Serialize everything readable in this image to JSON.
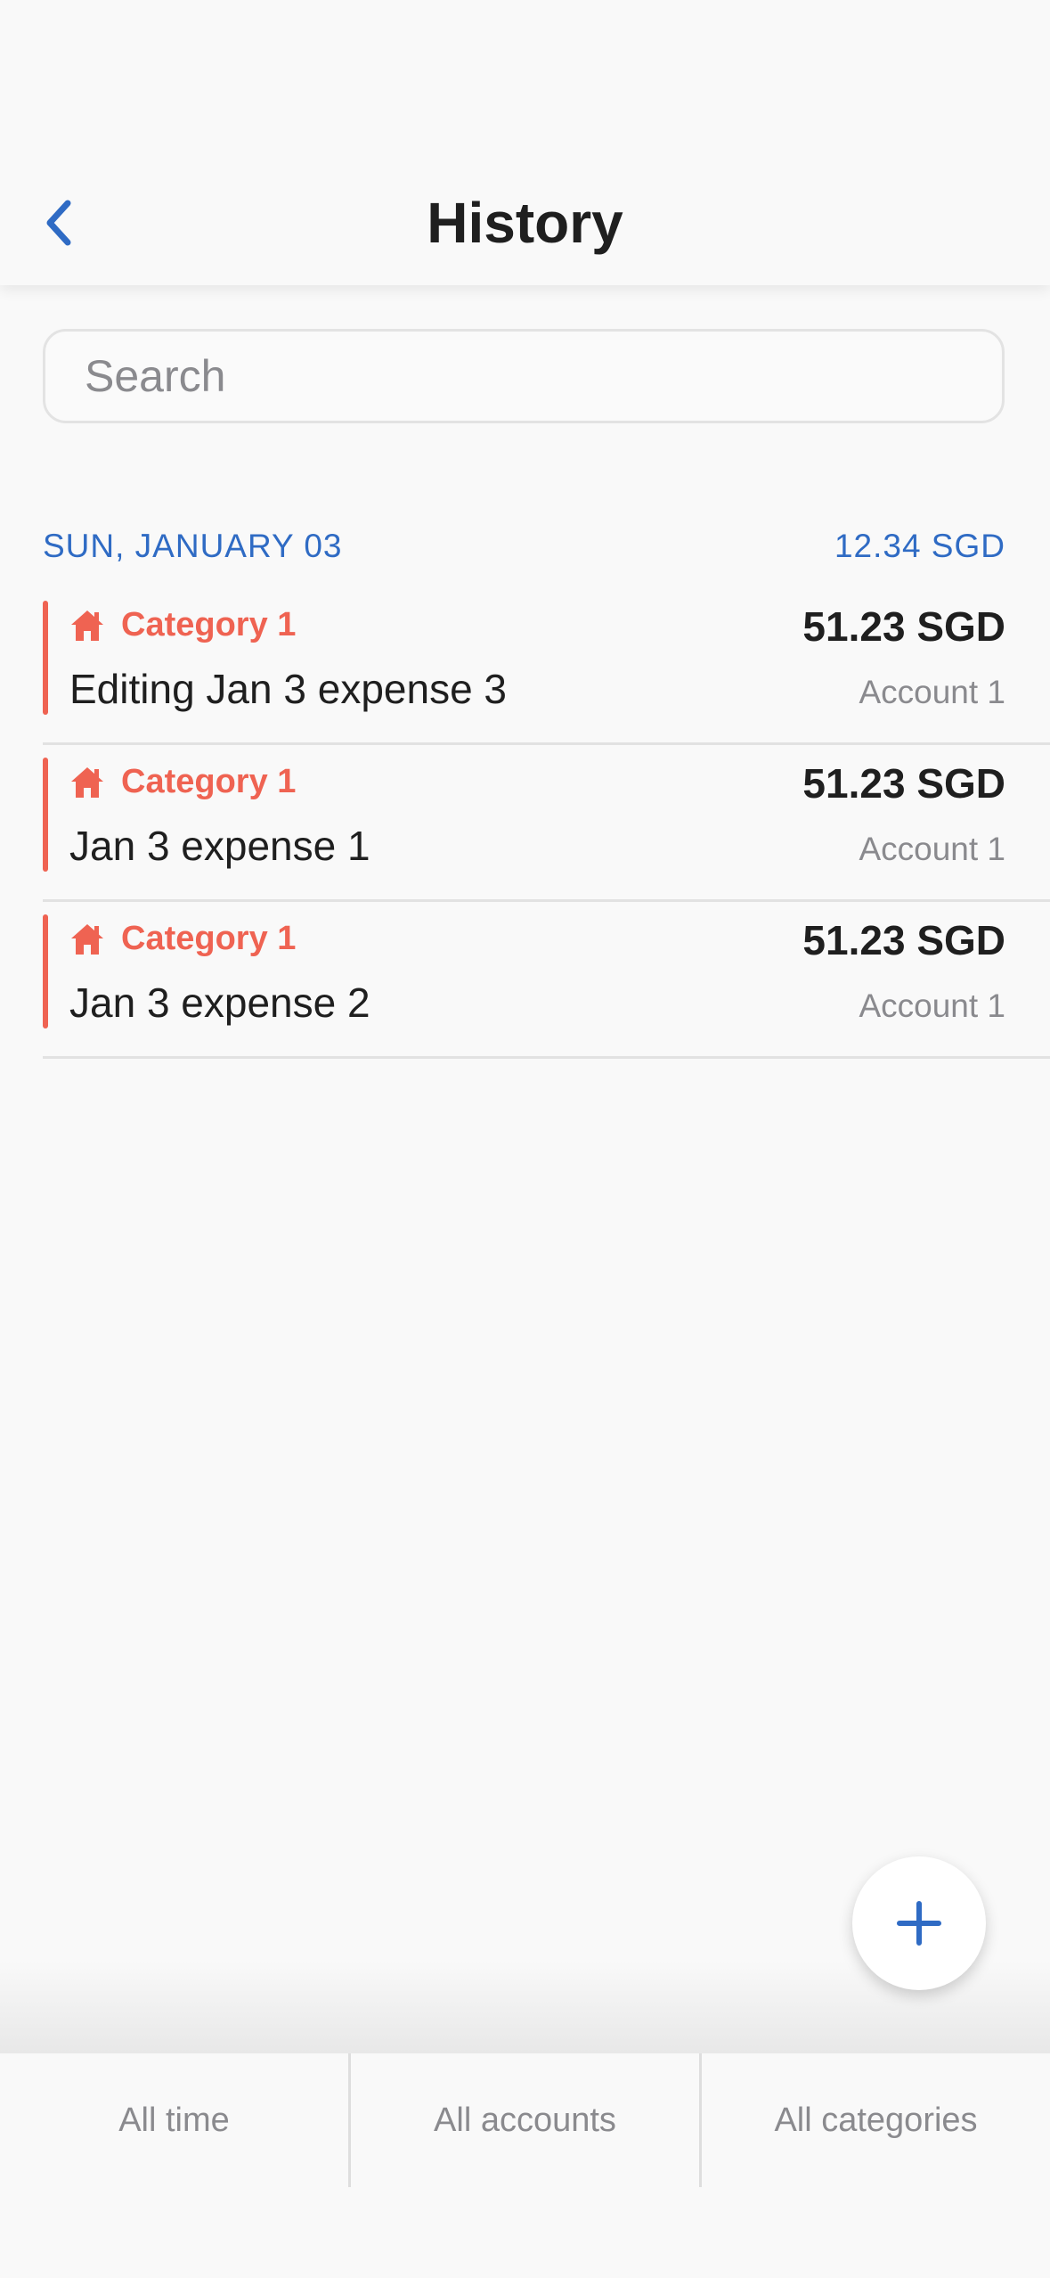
{
  "header": {
    "title": "History",
    "back_icon": "chevron-left-icon"
  },
  "search": {
    "placeholder": "Search",
    "value": ""
  },
  "day_group": {
    "date_label": "SUN, JANUARY 03",
    "total": "12.34 SGD"
  },
  "transactions": [
    {
      "category": "Category 1",
      "category_icon": "home-icon",
      "note": "Editing Jan 3 expense 3",
      "amount": "51.23 SGD",
      "account": "Account 1"
    },
    {
      "category": "Category 1",
      "category_icon": "home-icon",
      "note": "Jan 3 expense 1",
      "amount": "51.23 SGD",
      "account": "Account 1"
    },
    {
      "category": "Category 1",
      "category_icon": "home-icon",
      "note": "Jan 3 expense 2",
      "amount": "51.23 SGD",
      "account": "Account 1"
    }
  ],
  "fab": {
    "icon": "plus-icon"
  },
  "filters": {
    "time": "All time",
    "accounts": "All accounts",
    "categories": "All categories"
  },
  "colors": {
    "accent": "#2f6bc4",
    "category": "#ef6352",
    "muted": "#8a8a8e",
    "background": "#f9f9f9"
  }
}
